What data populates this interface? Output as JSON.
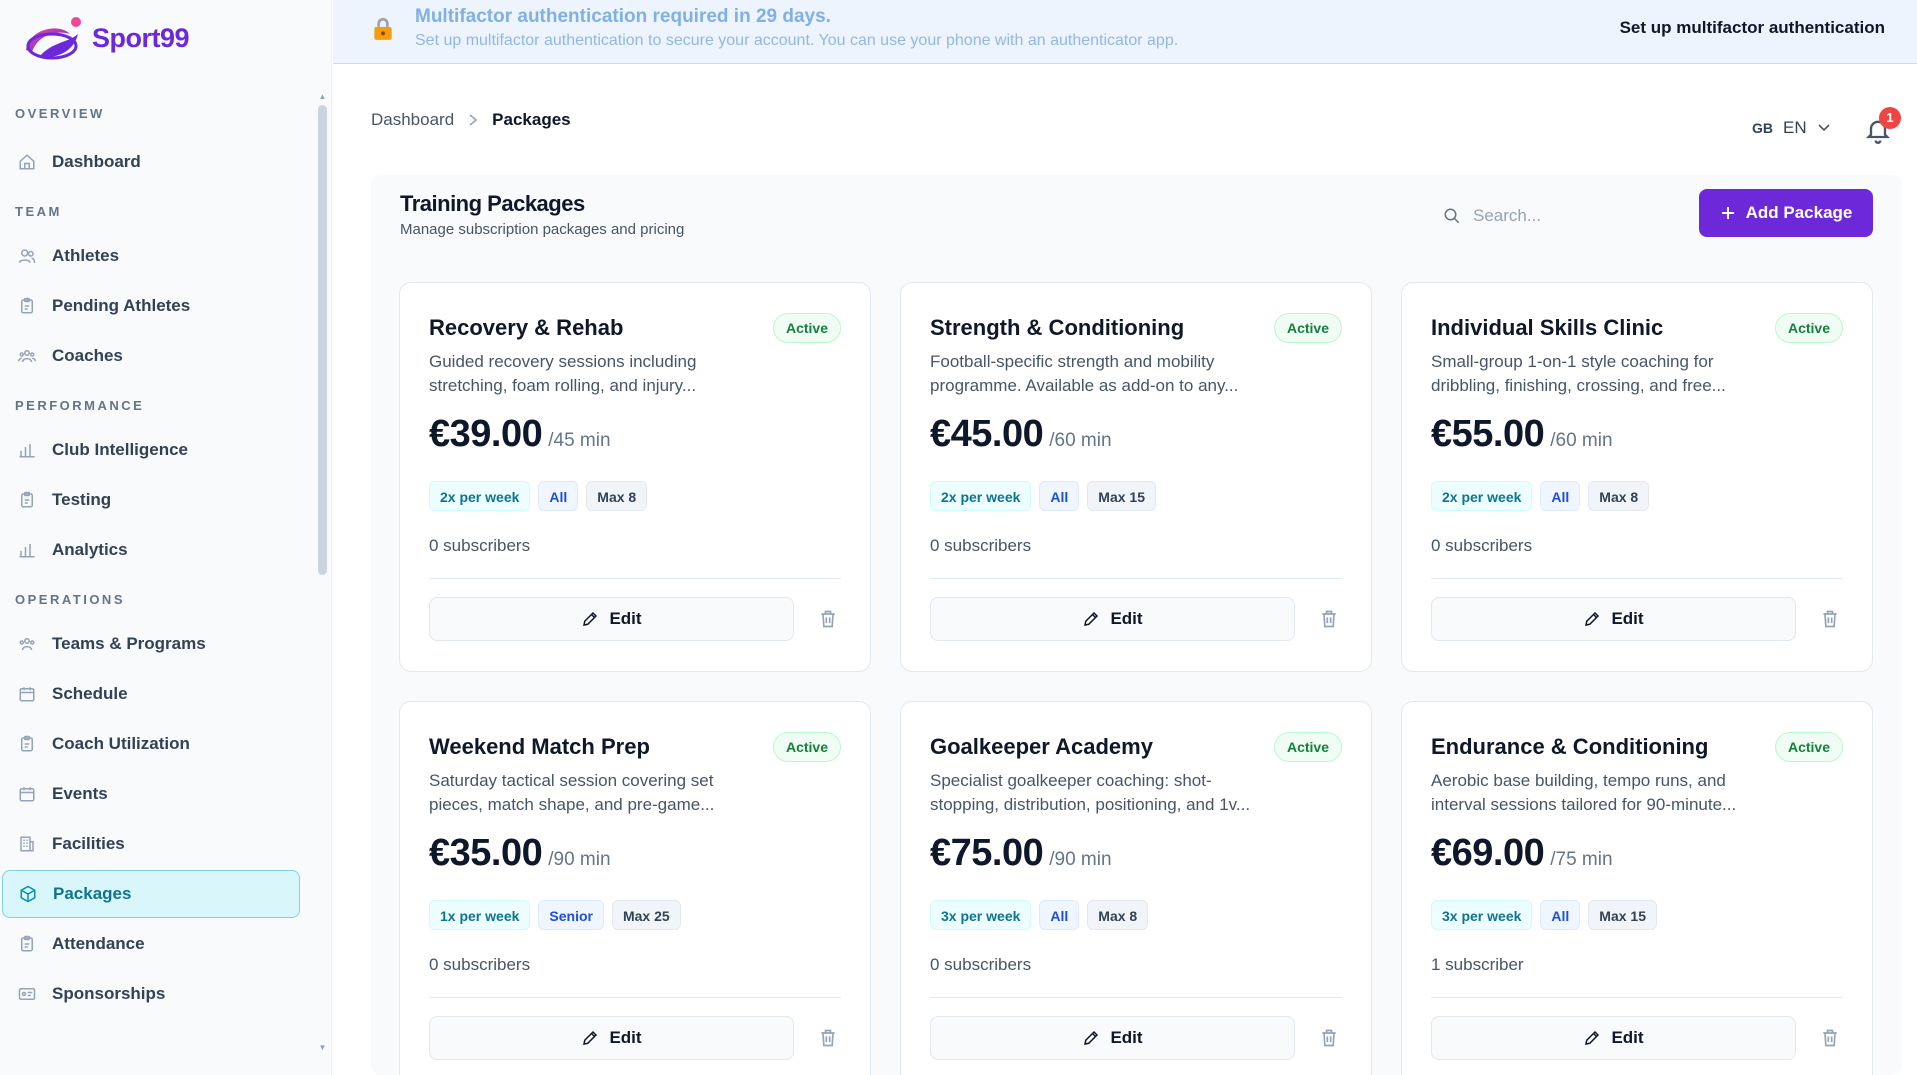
{
  "brand": {
    "name": "Sport99"
  },
  "banner": {
    "title": "Multifactor authentication required in 29 days.",
    "subtitle": "Set up multifactor authentication to secure your account. You can use your phone with an authenticator app.",
    "cta": "Set up multifactor authentication"
  },
  "sidebar": {
    "sections": [
      {
        "label": "OVERVIEW",
        "items": [
          {
            "label": "Dashboard",
            "icon": "home-icon"
          }
        ]
      },
      {
        "label": "TEAM",
        "items": [
          {
            "label": "Athletes",
            "icon": "users-icon"
          },
          {
            "label": "Pending Athletes",
            "icon": "clipboard-icon"
          },
          {
            "label": "Coaches",
            "icon": "group-icon"
          }
        ]
      },
      {
        "label": "PERFORMANCE",
        "items": [
          {
            "label": "Club Intelligence",
            "icon": "bar-chart-icon"
          },
          {
            "label": "Testing",
            "icon": "clipboard-icon"
          },
          {
            "label": "Analytics",
            "icon": "bar-chart-icon"
          }
        ]
      },
      {
        "label": "OPERATIONS",
        "items": [
          {
            "label": "Teams & Programs",
            "icon": "group-icon"
          },
          {
            "label": "Schedule",
            "icon": "calendar-icon"
          },
          {
            "label": "Coach Utilization",
            "icon": "clipboard-icon"
          },
          {
            "label": "Events",
            "icon": "calendar-icon"
          },
          {
            "label": "Facilities",
            "icon": "building-icon"
          },
          {
            "label": "Packages",
            "icon": "package-icon",
            "active": true
          },
          {
            "label": "Attendance",
            "icon": "clipboard-icon"
          },
          {
            "label": "Sponsorships",
            "icon": "id-card-icon"
          }
        ]
      }
    ]
  },
  "breadcrumb": {
    "parent": "Dashboard",
    "current": "Packages"
  },
  "language": {
    "flag": "GB",
    "code": "EN"
  },
  "notifications": {
    "count": "1"
  },
  "page": {
    "title": "Training Packages",
    "subtitle": "Manage subscription packages and pricing",
    "search_placeholder": "Search...",
    "add_label": "Add Package"
  },
  "packages": [
    {
      "name": "Recovery & Rehab",
      "status": "Active",
      "description": "Guided recovery sessions including stretching, foam rolling, and injury...",
      "price": "€39.00",
      "duration": "/45 min",
      "frequency": "2x per week",
      "level": "All",
      "max": "Max 8",
      "subscribers": "0 subscribers",
      "edit": "Edit"
    },
    {
      "name": "Strength & Conditioning",
      "status": "Active",
      "description": "Football-specific strength and mobility programme. Available as add-on to any...",
      "price": "€45.00",
      "duration": "/60 min",
      "frequency": "2x per week",
      "level": "All",
      "max": "Max 15",
      "subscribers": "0 subscribers",
      "edit": "Edit"
    },
    {
      "name": "Individual Skills Clinic",
      "status": "Active",
      "description": "Small-group 1-on-1 style coaching for dribbling, finishing, crossing, and free...",
      "price": "€55.00",
      "duration": "/60 min",
      "frequency": "2x per week",
      "level": "All",
      "max": "Max 8",
      "subscribers": "0 subscribers",
      "edit": "Edit"
    },
    {
      "name": "Weekend Match Prep",
      "status": "Active",
      "description": "Saturday tactical session covering set pieces, match shape, and pre-game...",
      "price": "€35.00",
      "duration": "/90 min",
      "frequency": "1x per week",
      "level": "Senior",
      "max": "Max 25",
      "subscribers": "0 subscribers",
      "edit": "Edit"
    },
    {
      "name": "Goalkeeper Academy",
      "status": "Active",
      "description": "Specialist goalkeeper coaching: shot-stopping, distribution, positioning, and 1v...",
      "price": "€75.00",
      "duration": "/90 min",
      "frequency": "3x per week",
      "level": "All",
      "max": "Max 8",
      "subscribers": "0 subscribers",
      "edit": "Edit"
    },
    {
      "name": "Endurance & Conditioning",
      "status": "Active",
      "description": "Aerobic base building, tempo runs, and interval sessions tailored for 90-minute...",
      "price": "€69.00",
      "duration": "/75 min",
      "frequency": "3x per week",
      "level": "All",
      "max": "Max 15",
      "subscribers": "1 subscriber",
      "edit": "Edit"
    }
  ],
  "colors": {
    "accent": "#6d28d9",
    "active_nav": "#d9f7fb",
    "success": "#15803d",
    "banner_bg": "#eef4fd"
  }
}
